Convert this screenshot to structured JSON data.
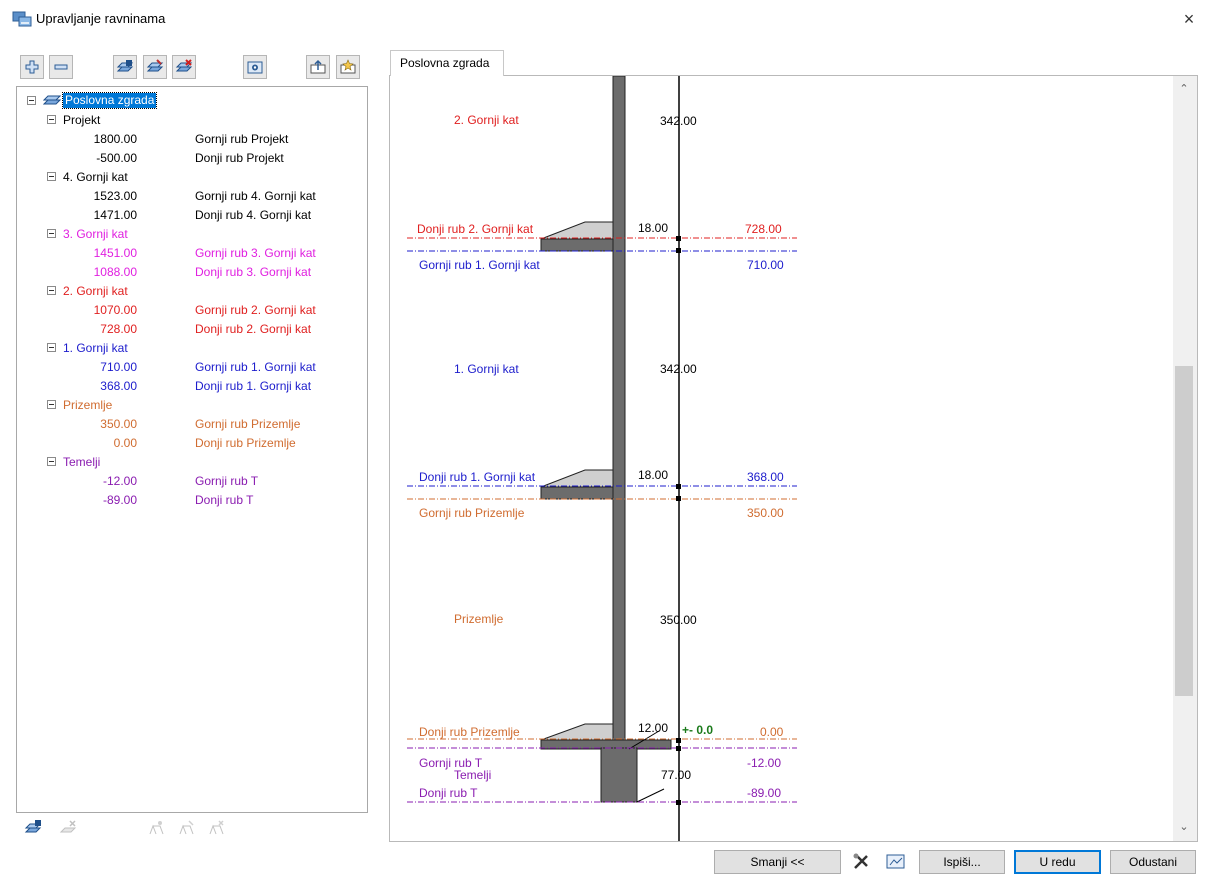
{
  "window": {
    "title": "Upravljanje ravninama",
    "close_glyph": "×",
    "icon": "levels-manager-icon"
  },
  "toolbar": {
    "buttons": [
      "add-plus-icon",
      "remove-minus-icon",
      "add-level-icon",
      "edit-level-icon",
      "delete-level-icon",
      "settings-gear-icon",
      "export-icon",
      "import-icon"
    ]
  },
  "tree": {
    "root": "Poslovna zgrada",
    "groups": [
      {
        "name": "Projekt",
        "color": "#000000",
        "rows": [
          {
            "value": "1800.00",
            "label": "Gornji rub Projekt"
          },
          {
            "value": "-500.00",
            "label": "Donji rub Projekt"
          }
        ]
      },
      {
        "name": "4. Gornji kat",
        "color": "#000000",
        "rows": [
          {
            "value": "1523.00",
            "label": "Gornji rub 4. Gornji kat"
          },
          {
            "value": "1471.00",
            "label": "Donji rub 4. Gornji kat"
          }
        ]
      },
      {
        "name": "3. Gornji kat",
        "color": "#e020e0",
        "rows": [
          {
            "value": "1451.00",
            "label": "Gornji rub 3. Gornji kat"
          },
          {
            "value": "1088.00",
            "label": "Donji rub 3. Gornji kat"
          }
        ]
      },
      {
        "name": "2. Gornji kat",
        "color": "#e02020",
        "rows": [
          {
            "value": "1070.00",
            "label": "Gornji rub 2. Gornji kat"
          },
          {
            "value": "728.00",
            "label": "Donji rub 2. Gornji kat"
          }
        ]
      },
      {
        "name": "1. Gornji kat",
        "color": "#1c1ccc",
        "rows": [
          {
            "value": "710.00",
            "label": "Gornji rub 1. Gornji kat"
          },
          {
            "value": "368.00",
            "label": "Donji rub 1. Gornji kat"
          }
        ]
      },
      {
        "name": "Prizemlje",
        "color": "#d06c30",
        "rows": [
          {
            "value": "350.00",
            "label": "Gornji rub Prizemlje"
          },
          {
            "value": "0.00",
            "label": "Donji rub Prizemlje"
          }
        ]
      },
      {
        "name": "Temelji",
        "color": "#8a1cb0",
        "rows": [
          {
            "value": "-12.00",
            "label": "Gornji rub T"
          },
          {
            "value": "-89.00",
            "label": "Donji rub T"
          }
        ]
      }
    ]
  },
  "bottom_left_buttons": [
    "add-sublevel-icon",
    "remove-sublevel-icon",
    "people-add-icon",
    "people-edit-icon",
    "people-delete-icon"
  ],
  "tab": {
    "label": "Poslovna zgrada"
  },
  "diagram": {
    "floors": [
      {
        "name": "2. Gornji kat",
        "height": "342.00",
        "color": "#e02020"
      },
      {
        "name": "1. Gornji kat",
        "height": "342.00",
        "color": "#1c1ccc"
      },
      {
        "name": "Prizemlje",
        "height": "350.00",
        "color": "#d06c30"
      },
      {
        "name": "Temelji",
        "height": "77.00",
        "color": "#8a1cb0"
      }
    ],
    "edges": [
      {
        "label": "Donji rub 2. Gornji kat",
        "value": "728.00",
        "color": "#e02020"
      },
      {
        "label": "Gornji rub 1. Gornji kat",
        "value": "710.00",
        "color": "#1c1ccc"
      },
      {
        "label": "Donji rub 1. Gornji kat",
        "value": "368.00",
        "color": "#1c1ccc"
      },
      {
        "label": "Gornji rub Prizemlje",
        "value": "350.00",
        "color": "#d06c30"
      },
      {
        "label": "Donji rub Prizemlje",
        "value": "0.00",
        "color": "#d06c30"
      },
      {
        "label": "Gornji rub T",
        "value": "-12.00",
        "color": "#8a1cb0"
      },
      {
        "label": "Donji rub T",
        "value": "-89.00",
        "color": "#8a1cb0"
      }
    ],
    "slab_thicknesses": [
      "18.00",
      "18.00",
      "12.00"
    ],
    "zero_marker": "+- 0.0",
    "zero_color": "#1a7a1a"
  },
  "buttons": {
    "smanji": "Smanji <<",
    "ispisi": "Ispiši...",
    "ok": "U redu",
    "cancel": "Odustani"
  }
}
